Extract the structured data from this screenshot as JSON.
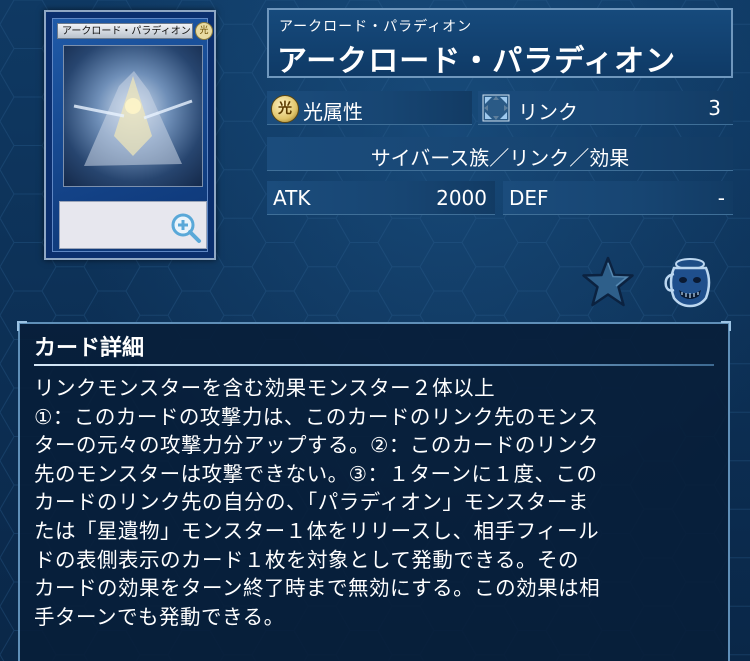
{
  "card": {
    "name_ruby": "アークロード・パラディオン",
    "name": "アークロード・パラディオン",
    "card_image_name": "アークロード・パラディオン",
    "card_image_attribute_glyph": "光"
  },
  "stats": {
    "attribute_glyph": "光",
    "attribute": "光属性",
    "link_label": "リンク",
    "link_value": "3",
    "type": "サイバース族／リンク／効果",
    "atk_label": "ATK",
    "atk_value": "2000",
    "def_label": "DEF",
    "def_value": "-"
  },
  "icons": {
    "favorite": "star-icon",
    "deck": "jar-icon",
    "zoom": "magnify-icon"
  },
  "detail": {
    "title": "カード詳細",
    "lines": [
      "リンクモンスターを含む効果モンスター２体以上",
      "①：このカードの攻撃力は、このカードのリンク先のモンス",
      "ターの元々の攻撃力分アップする。②：このカードのリンク",
      "先のモンスターは攻撃できない。③：１ターンに１度、この",
      "カードのリンク先の自分の、「パラディオン」モンスターま",
      "たは「星遺物」モンスター１体をリリースし、相手フィール",
      "ドの表側表示のカード１枚を対象として発動できる。その",
      "カードの効果をターン終了時まで無効にする。この効果は相",
      "手ターンでも発動できる。"
    ]
  },
  "colors": {
    "background": "#0d2f55",
    "panel_border": "#6f97bd",
    "accent_gold": "#e0c56a"
  }
}
